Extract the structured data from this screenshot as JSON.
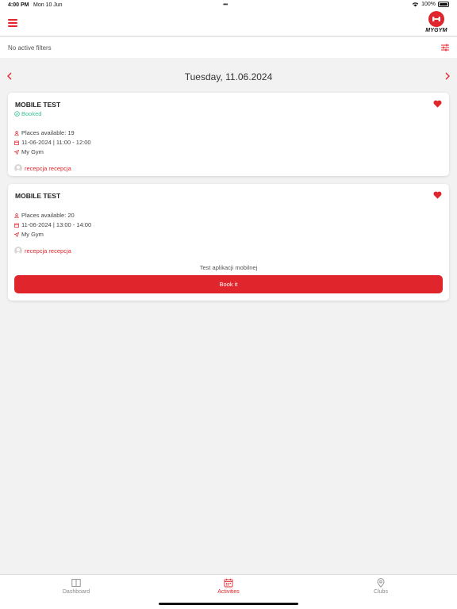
{
  "status_bar": {
    "time": "4:00 PM",
    "date": "Mon 10 Jun",
    "dots": "•••",
    "battery": "100%"
  },
  "header": {
    "logo_text": "MYGYM"
  },
  "filters": {
    "text": "No active filters"
  },
  "date_nav": {
    "title": "Tuesday, 11.06.2024"
  },
  "activities": [
    {
      "title": "MOBILE TEST",
      "status": "Booked",
      "places": "Places available: 19",
      "datetime": "11-06-2024 | 11:00 - 12:00",
      "location": "My Gym",
      "trainer": "recepcja recepcja",
      "favorite": true
    },
    {
      "title": "MOBILE TEST",
      "places": "Places available: 20",
      "datetime": "11-06-2024 | 13:00 - 14:00",
      "location": "My Gym",
      "trainer": "recepcja recepcja",
      "description": "Test aplikacji mobilnej",
      "button": "Book it",
      "favorite": true
    }
  ],
  "tabs": [
    {
      "label": "Dashboard",
      "icon": "book-icon",
      "active": false
    },
    {
      "label": "Activities",
      "icon": "calendar-icon",
      "active": true
    },
    {
      "label": "Clubs",
      "icon": "location-pin-icon",
      "active": false
    }
  ],
  "colors": {
    "accent": "#e0262c",
    "booked": "#3fc495"
  }
}
